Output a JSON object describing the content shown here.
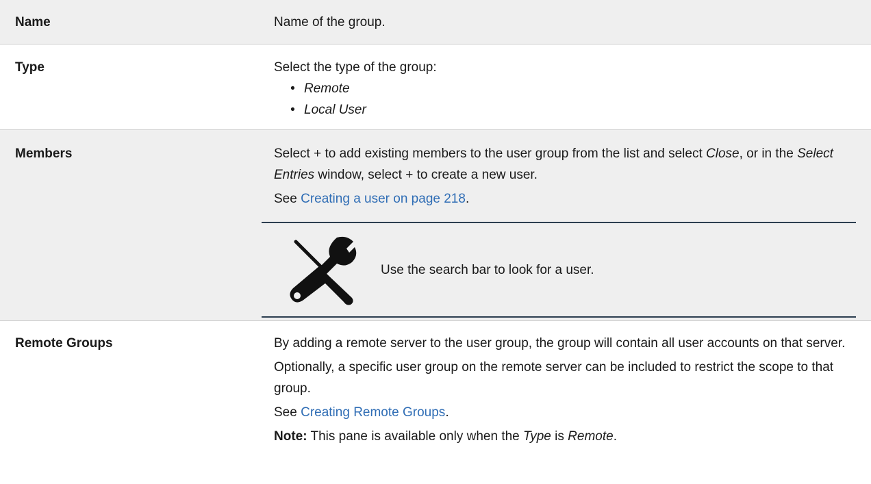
{
  "rows": {
    "name": {
      "label": "Name",
      "desc": "Name of the group."
    },
    "type": {
      "label": "Type",
      "desc": "Select the type of the group:",
      "options": [
        "Remote",
        "Local User"
      ]
    },
    "members": {
      "label": "Members",
      "desc_part1": "Select + to add existing members to the user group from the list and select ",
      "desc_close": "Close",
      "desc_part2": ", or in the ",
      "desc_select_entries": "Select Entries",
      "desc_part3": " window, select + to create a new user.",
      "see_prefix": "See ",
      "see_link": "Creating a user on page 218",
      "see_suffix": ".",
      "tip_icon": "tools-icon",
      "tip_text": "Use the search bar to look for a user."
    },
    "remote_groups": {
      "label": "Remote Groups",
      "para1": "By adding a remote server to the user group, the group will contain all user accounts on that server.",
      "para2": "Optionally, a specific user group on the remote server can be included to restrict the scope to that group.",
      "see_prefix": "See ",
      "see_link": "Creating Remote Groups",
      "see_suffix": ".",
      "note_label": "Note:",
      "note_part1": " This pane is available only when the ",
      "note_type": "Type",
      "note_part2": " is ",
      "note_remote": "Remote",
      "note_part3": "."
    }
  },
  "colors": {
    "shaded_row": "#efefef",
    "link": "#2f6db5",
    "rule": "#2c3e50"
  }
}
